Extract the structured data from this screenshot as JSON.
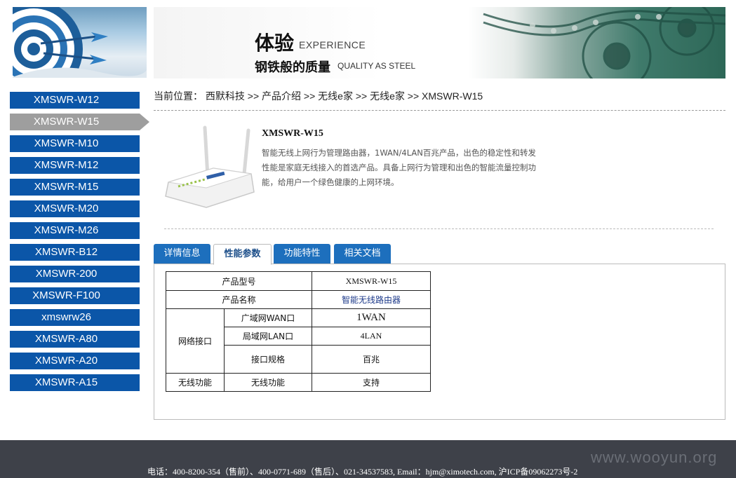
{
  "banner": {
    "title_cn": "体验",
    "title_en": "EXPERIENCE",
    "subtitle_cn": "钢铁般的质量",
    "subtitle_en": "QUALITY AS STEEL"
  },
  "sidebar": {
    "items": [
      {
        "label": "XMSWR-W12",
        "active": false
      },
      {
        "label": "XMSWR-W15",
        "active": true
      },
      {
        "label": "XMSWR-M10",
        "active": false
      },
      {
        "label": "XMSWR-M12",
        "active": false
      },
      {
        "label": "XMSWR-M15",
        "active": false
      },
      {
        "label": "XMSWR-M20",
        "active": false
      },
      {
        "label": "XMSWR-M26",
        "active": false
      },
      {
        "label": "XMSWR-B12",
        "active": false
      },
      {
        "label": "XMSWR-200",
        "active": false
      },
      {
        "label": "XMSWR-F100",
        "active": false
      },
      {
        "label": "xmswrw26",
        "active": false
      },
      {
        "label": "XMSWR-A80",
        "active": false
      },
      {
        "label": "XMSWR-A20",
        "active": false
      },
      {
        "label": "XMSWR-A15",
        "active": false
      }
    ]
  },
  "breadcrumb": {
    "prefix": "当前位置：",
    "items": [
      "西默科技",
      "产品介绍",
      "无线e家",
      "无线e家",
      "XMSWR-W15"
    ],
    "separator": ">>"
  },
  "product": {
    "title": "XMSWR-W15",
    "description": "智能无线上网行为管理路由器，1WAN/4LAN百兆产品，出色的稳定性和转发性能是家庭无线接入的首选产品。具备上网行为管理和出色的智能流量控制功能，给用户一个绿色健康的上网环境。",
    "device_label": "Ximo 西默科技"
  },
  "tabs": [
    {
      "label": "详情信息",
      "active": false
    },
    {
      "label": "性能参数",
      "active": true
    },
    {
      "label": "功能特性",
      "active": false
    },
    {
      "label": "相关文档",
      "active": false
    }
  ],
  "spec": {
    "model_label": "产品型号",
    "model_value": "XMSWR-W15",
    "name_label": "产品名称",
    "name_value": "智能无线路由器",
    "network_label": "网络接口",
    "wan_label": "广域网WAN口",
    "wan_value": "1WAN",
    "lan_label": "局域网LAN口",
    "lan_value": "4LAN",
    "port_spec_label": "接口规格",
    "port_spec_value": "百兆",
    "wireless_label": "无线功能",
    "wireless_sub_label": "无线功能",
    "wireless_value": "支持"
  },
  "footer": {
    "text": "电话：400-8200-354（售前）、400-0771-689（售后）、021-34537583, Email：hjm@ximotech.com, 沪ICP备09062273号-2",
    "watermark": "www.wooyun.org"
  },
  "colors": {
    "nav_blue": "#0b56a8",
    "nav_active": "#9e9e9e",
    "tab_blue": "#1d6fbd",
    "footer_bg": "#3e4149"
  }
}
